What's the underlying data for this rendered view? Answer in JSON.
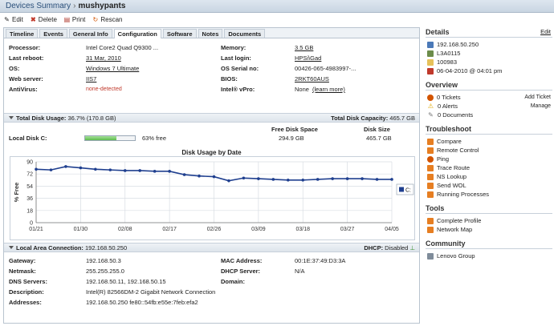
{
  "header": {
    "section": "Devices Summary",
    "separator": "›",
    "device": "mushypants"
  },
  "toolbar": {
    "edit": "Edit",
    "delete": "Delete",
    "print": "Print",
    "rescan": "Rescan"
  },
  "tabs": [
    "Timeline",
    "Events",
    "General Info",
    "Configuration",
    "Software",
    "Notes",
    "Documents"
  ],
  "config": {
    "processor_label": "Processor:",
    "processor": "Intel Core2 Quad Q9300 ...",
    "last_reboot_label": "Last reboot:",
    "last_reboot": "31 Mar, 2010",
    "os_label": "OS:",
    "os": "Windows 7 Ultimate",
    "web_server_label": "Web server:",
    "web_server": "IIS7",
    "antivirus_label": "AntiVirus:",
    "antivirus": "none-detected",
    "memory_label": "Memory:",
    "memory": "3.5 GB",
    "last_login_label": "Last login:",
    "last_login": "HPSi\\Gad",
    "os_serial_label": "OS Serial no:",
    "os_serial": "00426-065-4983997-...",
    "bios_label": "BIOS:",
    "bios": "2RKT60AUS",
    "vpro_label": "Intel® vPro:",
    "vpro": "None",
    "vpro_link": "(learn more)"
  },
  "disk": {
    "bar_label": "Total Disk Usage:",
    "bar_value": "36.7% (170.8 GB)",
    "capacity_label": "Total Disk Capacity:",
    "capacity": "465.7 GB",
    "free_header": "Free Disk Space",
    "size_header": "Disk Size",
    "drive_label": "Local Disk C:",
    "free_pct": "63% free",
    "free_fraction": 0.63,
    "free": "294.9 GB",
    "size": "465.7 GB"
  },
  "chart_data": {
    "type": "line",
    "title": "Disk Usage by Date",
    "ylabel": "% Free",
    "xlabel": "",
    "ylim": [
      0,
      90
    ],
    "yticks": [
      0,
      18,
      36,
      54,
      72,
      90
    ],
    "xtick_labels": [
      "01/21",
      "01/30",
      "02/08",
      "02/17",
      "02/26",
      "03/09",
      "03/18",
      "03/27",
      "04/05"
    ],
    "grid": true,
    "legend_position": "right",
    "series": [
      {
        "name": "C:",
        "color": "#1f3f8f",
        "x": [
          0,
          1,
          2,
          3,
          4,
          5,
          6,
          7,
          8,
          9,
          10,
          11,
          12,
          13,
          14,
          15,
          16,
          17,
          18,
          19,
          20,
          21,
          22,
          23,
          24
        ],
        "values": [
          79,
          78,
          83,
          81,
          79,
          78,
          77,
          77,
          76,
          76,
          71,
          69,
          68,
          62,
          66,
          65,
          64,
          63,
          63,
          64,
          65,
          65,
          65,
          64,
          64
        ]
      }
    ]
  },
  "lan": {
    "title": "Local Area Connection:",
    "ip": "192.168.50.250",
    "dhcp_label": "DHCP:",
    "dhcp_value": "Disabled",
    "gateway_label": "Gateway:",
    "gateway": "192.168.50.3",
    "netmask_label": "Netmask:",
    "netmask": "255.255.255.0",
    "dns_label": "DNS Servers:",
    "dns": "192.168.50.11, 192.168.50.15",
    "desc_label": "Description:",
    "desc": "Intel(R) 82566DM-2 Gigabit Network Connection",
    "addresses_label": "Addresses:",
    "addresses": "192.168.50.250 fe80::54fb:e55e:7feb:efa2",
    "mac_label": "MAC Address:",
    "mac": "00:1E:37:49:D3:3A",
    "dhcp_server_label": "DHCP Server:",
    "dhcp_server": "N/A",
    "domain_label": "Domain:",
    "domain": ""
  },
  "sidebar": {
    "details_title": "Details",
    "edit": "Edit",
    "ip": "192.168.50.250",
    "name": "L3A0115",
    "asset": "100983",
    "date": "06-04-2010 @ 04:01 pm",
    "overview_title": "Overview",
    "tickets": "0 Tickets",
    "add_ticket": "Add Ticket",
    "alerts": "0 Alerts",
    "manage": "Manage",
    "documents": "0 Documents",
    "troubleshoot_title": "Troubleshoot",
    "troubleshoot": [
      "Compare",
      "Remote Control",
      "Ping",
      "Trace Route",
      "NS Lookup",
      "Send WOL",
      "Running Processes"
    ],
    "tools_title": "Tools",
    "tools": [
      "Complete Profile",
      "Network Map"
    ],
    "community_title": "Community",
    "community": [
      "Lenovo Group"
    ]
  }
}
